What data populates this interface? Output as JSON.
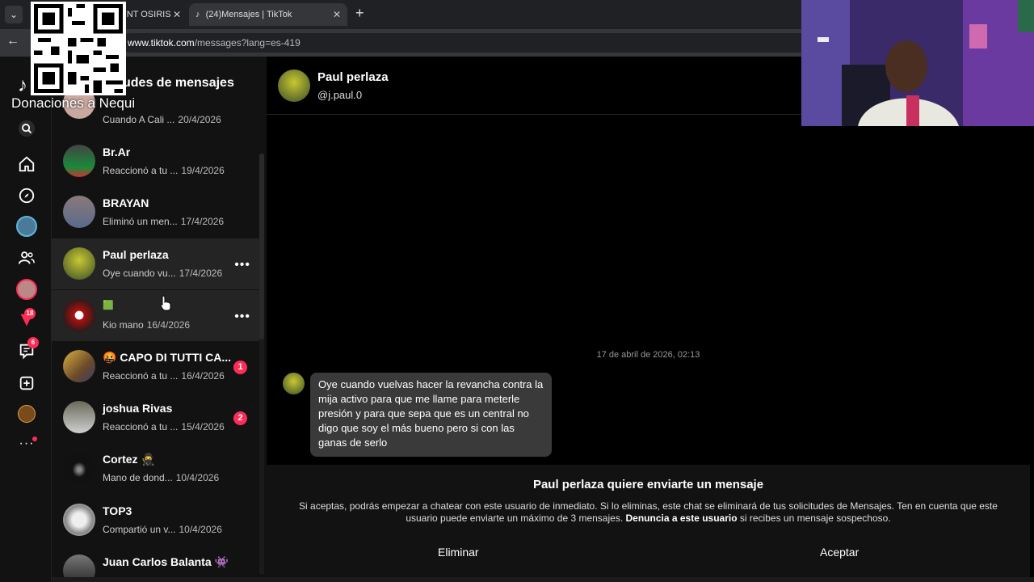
{
  "browser": {
    "tabs": [
      {
        "label": "- NT OSIRIS",
        "active": false
      },
      {
        "label": "(24)Mensajes | TikTok",
        "active": true
      }
    ],
    "url_host": "www.tiktok.com",
    "url_path": "/messages?lang=es-419"
  },
  "overlay": {
    "donations_text": "Donaciones a Nequi"
  },
  "sidebar_nav": {
    "notifications_badge": "18",
    "messages_badge": "6"
  },
  "requests_panel": {
    "title": "Solicitudes de mensajes",
    "title_visible": "udes de mensajes",
    "conversations": [
      {
        "name": "",
        "preview": "Cuando A Cali ...",
        "date": "20/4/2026"
      },
      {
        "name": "Br.Ar",
        "preview": "Reaccionó a tu ...",
        "date": "19/4/2026"
      },
      {
        "name": "BRAYAN",
        "preview": "Eliminó un men...",
        "date": "17/4/2026"
      },
      {
        "name": "Paul perlaza",
        "preview": "Oye cuando vu...",
        "date": "17/4/2026"
      },
      {
        "name": "🟩",
        "preview": "Kio mano",
        "date": "16/4/2026"
      },
      {
        "name": "🤬 CAPO DI TUTTI CA...",
        "preview": "Reaccionó a tu ...",
        "date": "16/4/2026",
        "unread": "1"
      },
      {
        "name": "joshua Rivas",
        "preview": "Reaccionó a tu ...",
        "date": "15/4/2026",
        "unread": "2"
      },
      {
        "name": "Cortez 🥷",
        "preview": "Mano de dond...",
        "date": "10/4/2026"
      },
      {
        "name": "TOP3",
        "preview": "Compartió un v...",
        "date": "10/4/2026"
      },
      {
        "name": "Juan Carlos Balanta 👾",
        "preview": "",
        "date": ""
      }
    ]
  },
  "chat": {
    "name": "Paul perlaza",
    "handle": "@j.paul.0",
    "timestamp": "17 de abril de 2026, 02:13",
    "message": "Oye cuando vuelvas hacer la revancha contra la mija activo para que me llame para meterle presión y para que sepa que es un central no digo que soy el más bueno pero si con las ganas de serlo",
    "request_title": "Paul perlaza quiere enviarte un mensaje",
    "request_body_1": "Si aceptas, podrás empezar a chatear con este usuario de inmediato. Si lo eliminas, este chat se eliminará de tus solicitudes de Mensajes. Ten en cuenta que este usuario puede enviarte un máximo de 3 mensajes.",
    "request_report": "Denuncia a este usuario",
    "request_body_2": "si recibes un mensaje sospechoso.",
    "delete_label": "Eliminar",
    "accept_label": "Aceptar"
  },
  "colors": {
    "accent": "#fe2c55",
    "panel": "#121212",
    "bubble": "#3a3a3a"
  }
}
